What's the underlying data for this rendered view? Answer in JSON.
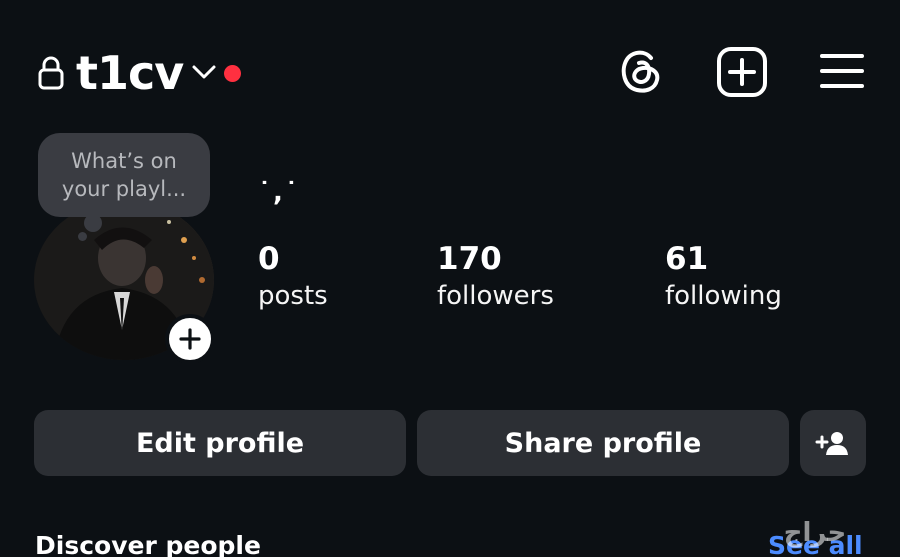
{
  "header": {
    "username": "t1cv",
    "icons": {
      "lock": "lock-icon",
      "chevron": "chevron-down-icon",
      "threads": "threads-icon",
      "create": "create-post-icon",
      "menu": "menu-icon"
    },
    "notification_dot_color": "#ff3040"
  },
  "profile": {
    "note": {
      "line1": "What’s on",
      "line2": "your playl..."
    },
    "display_name": "˙,˙",
    "stats": [
      {
        "value": "0",
        "label": "posts"
      },
      {
        "value": "170",
        "label": "followers"
      },
      {
        "value": "61",
        "label": "following"
      }
    ]
  },
  "actions": {
    "edit_profile": "Edit profile",
    "share_profile": "Share profile",
    "add_user_icon": "add-person-icon"
  },
  "discover": {
    "title": "Discover people",
    "see_all": "See all"
  },
  "watermark": "حراج",
  "colors": {
    "background": "#0c1014",
    "button": "#2c2f34",
    "note_bubble": "#3a3c42",
    "link": "#4c8cff",
    "notification": "#ff3040"
  }
}
